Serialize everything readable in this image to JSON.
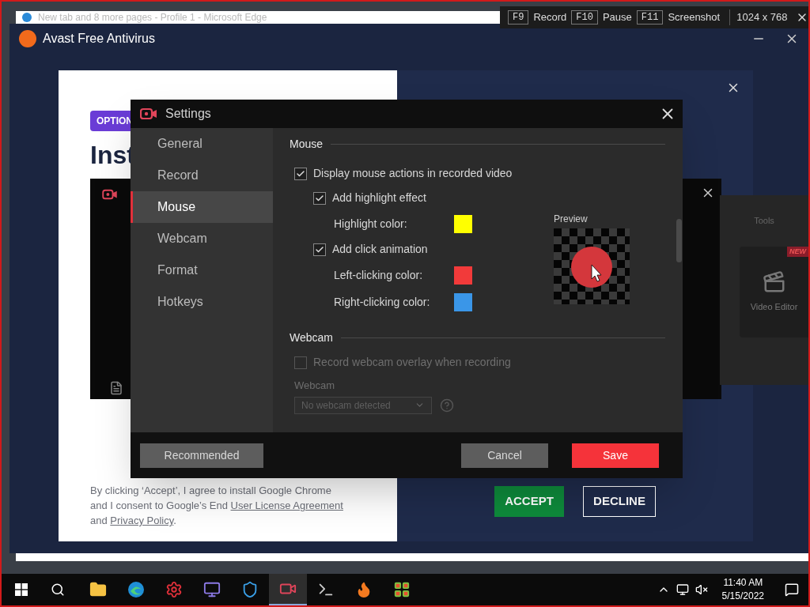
{
  "browser_tab": {
    "title": "New tab and 8 more pages - Profile 1 - Microsoft Edge"
  },
  "capture_bar": {
    "keys": [
      {
        "key": "F9",
        "label": "Record"
      },
      {
        "key": "F10",
        "label": "Pause"
      },
      {
        "key": "F11",
        "label": "Screenshot"
      }
    ],
    "resolution": "1024 x 768"
  },
  "avast": {
    "title": "Avast Free Antivirus",
    "badge": "OPTION",
    "heading": "Inst",
    "consent": [
      {
        "text": "By clicking ‘Accept’, I agree to install Google Chrome and I consent to Google’s End ",
        "link": false
      },
      {
        "text": "User License Agreement",
        "link": true
      },
      {
        "text": " and ",
        "link": false
      },
      {
        "text": "Privacy Policy",
        "link": true
      },
      {
        "text": ".",
        "link": false
      }
    ],
    "accept": "ACCEPT",
    "decline": "DECLINE"
  },
  "settings": {
    "title": "Settings",
    "nav": [
      {
        "label": "General",
        "selected": false
      },
      {
        "label": "Record",
        "selected": false
      },
      {
        "label": "Mouse",
        "selected": true
      },
      {
        "label": "Webcam",
        "selected": false
      },
      {
        "label": "Format",
        "selected": false
      },
      {
        "label": "Hotkeys",
        "selected": false
      }
    ],
    "mouse": {
      "heading": "Mouse",
      "preview": "Preview",
      "options": [
        {
          "kind": "checkbox",
          "label": "Display mouse actions in recorded video",
          "checked": true,
          "disabled": false,
          "children": [
            {
              "kind": "checkbox",
              "label": "Add highlight effect",
              "checked": true,
              "disabled": false,
              "children": [
                {
                  "kind": "color",
                  "label": "Highlight color:",
                  "color": "#ffff00"
                }
              ]
            },
            {
              "kind": "checkbox",
              "label": "Add click animation",
              "checked": true,
              "disabled": false,
              "children": [
                {
                  "kind": "color",
                  "label": "Left-clicking color:",
                  "color": "#f23a3a"
                },
                {
                  "kind": "color",
                  "label": "Right-clicking color:",
                  "color": "#3a96e8"
                }
              ]
            }
          ]
        }
      ]
    },
    "webcam": {
      "heading": "Webcam",
      "overlay": {
        "label": "Record webcam overlay when recording",
        "checked": false,
        "disabled": true
      },
      "field_label": "Webcam",
      "dropdown": "No webcam detected"
    },
    "buttons": {
      "recommended": "Recommended",
      "cancel": "Cancel",
      "save": "Save"
    }
  },
  "tools": {
    "title": "Tools",
    "badge": "NEW",
    "card_label": "Video Editor"
  },
  "taskbar": {
    "apps": [
      {
        "kind": "files",
        "selected": false
      },
      {
        "kind": "browser",
        "selected": false
      },
      {
        "kind": "gear",
        "selected": false
      },
      {
        "kind": "monitor",
        "selected": false
      },
      {
        "kind": "shield",
        "selected": false
      },
      {
        "kind": "recorder",
        "selected": true
      },
      {
        "kind": "terminal",
        "selected": false
      },
      {
        "kind": "flame",
        "selected": false
      },
      {
        "kind": "grid",
        "selected": false
      }
    ],
    "time": "11:40 AM",
    "date": "5/15/2022"
  }
}
